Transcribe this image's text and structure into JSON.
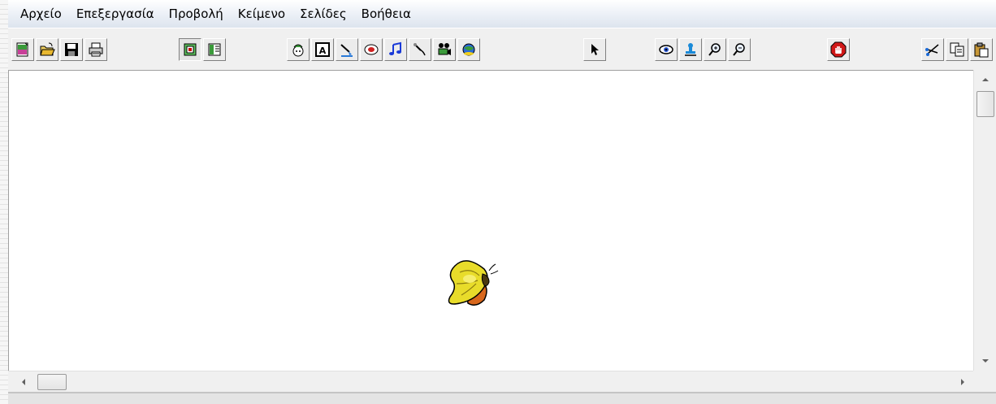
{
  "menu": {
    "items": [
      {
        "label": "Αρχείο"
      },
      {
        "label": "Επεξεργασία"
      },
      {
        "label": "Προβολή"
      },
      {
        "label": "Κείμενο"
      },
      {
        "label": "Σελίδες"
      },
      {
        "label": "Βοήθεια"
      }
    ]
  },
  "toolbar": {
    "groups": [
      {
        "icons": [
          "new-page-icon",
          "open-folder-icon",
          "save-disk-icon",
          "print-icon"
        ]
      },
      {
        "icons": [
          "page-view-icon",
          "book-view-icon"
        ]
      },
      {
        "icons": [
          "picture-icon",
          "text-box-icon",
          "painter-icon",
          "button-icon",
          "music-note-icon",
          "record-sound-icon",
          "video-camera-icon",
          "web-link-icon"
        ]
      },
      {
        "icons": [
          "select-pointer-icon"
        ]
      },
      {
        "icons": [
          "preview-eye-icon",
          "stamp-icon",
          "zoom-in-icon",
          "zoom-out-icon"
        ]
      },
      {
        "icons": [
          "stop-hand-icon"
        ]
      },
      {
        "icons": [
          "cut-scissors-icon",
          "copy-icon",
          "paste-icon"
        ]
      }
    ]
  },
  "colors": {
    "menu_gradient_top": "#ffffff",
    "menu_gradient_bottom": "#dde4ee",
    "toolbar_bg": "#f0f0f0",
    "canvas_bg": "#ffffff",
    "butterfly_wing": "#e8dc2a",
    "butterfly_body": "#d8671c"
  },
  "canvas": {
    "objects": [
      {
        "name": "butterfly-clipart",
        "icon": "butterfly-icon"
      }
    ]
  }
}
